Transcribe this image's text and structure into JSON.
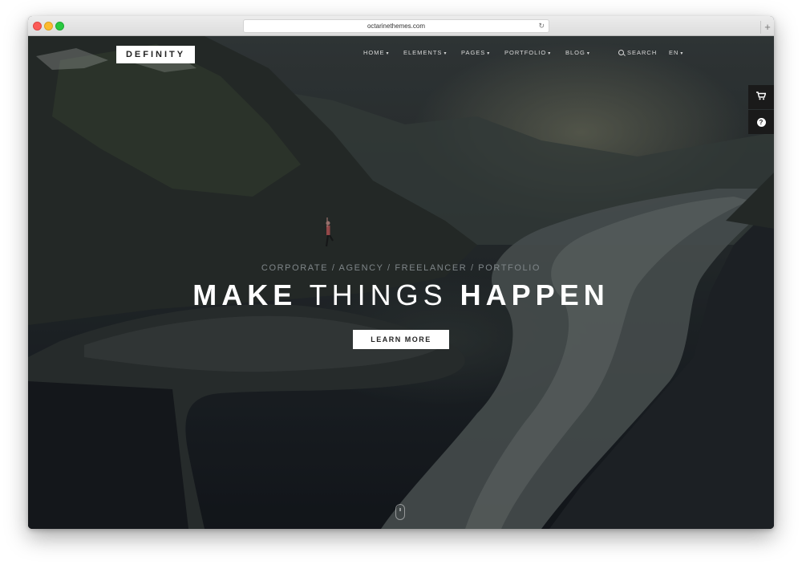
{
  "browser": {
    "url": "octarinethemes.com",
    "reload_icon": "reload-icon",
    "new_tab_icon": "plus-icon",
    "new_tab_glyph": "+"
  },
  "site": {
    "logo": "DEFINITY",
    "nav": [
      {
        "label": "HOME",
        "caret": "▾"
      },
      {
        "label": "ELEMENTS",
        "caret": "▾"
      },
      {
        "label": "PAGES",
        "caret": "▾"
      },
      {
        "label": "PORTFOLIO",
        "caret": "▾"
      },
      {
        "label": "BLOG",
        "caret": "▾"
      }
    ],
    "search_label": "SEARCH",
    "language": {
      "label": "EN",
      "caret": "▾"
    },
    "side_buttons": [
      {
        "icon": "cart-icon",
        "glyph": "🛒"
      },
      {
        "icon": "question-icon",
        "glyph": "?"
      }
    ]
  },
  "hero": {
    "tagline": "CORPORATE / AGENCY / FREELANCER / PORTFOLIO",
    "headline_word1": "MAKE",
    "headline_word2": "THINGS",
    "headline_word3": "HAPPEN",
    "cta": "LEARN MORE",
    "scroll_icon": "mouse-scroll-icon"
  },
  "colors": {
    "accent": "#ffffff",
    "dark_panel": "#1a1a1a"
  }
}
